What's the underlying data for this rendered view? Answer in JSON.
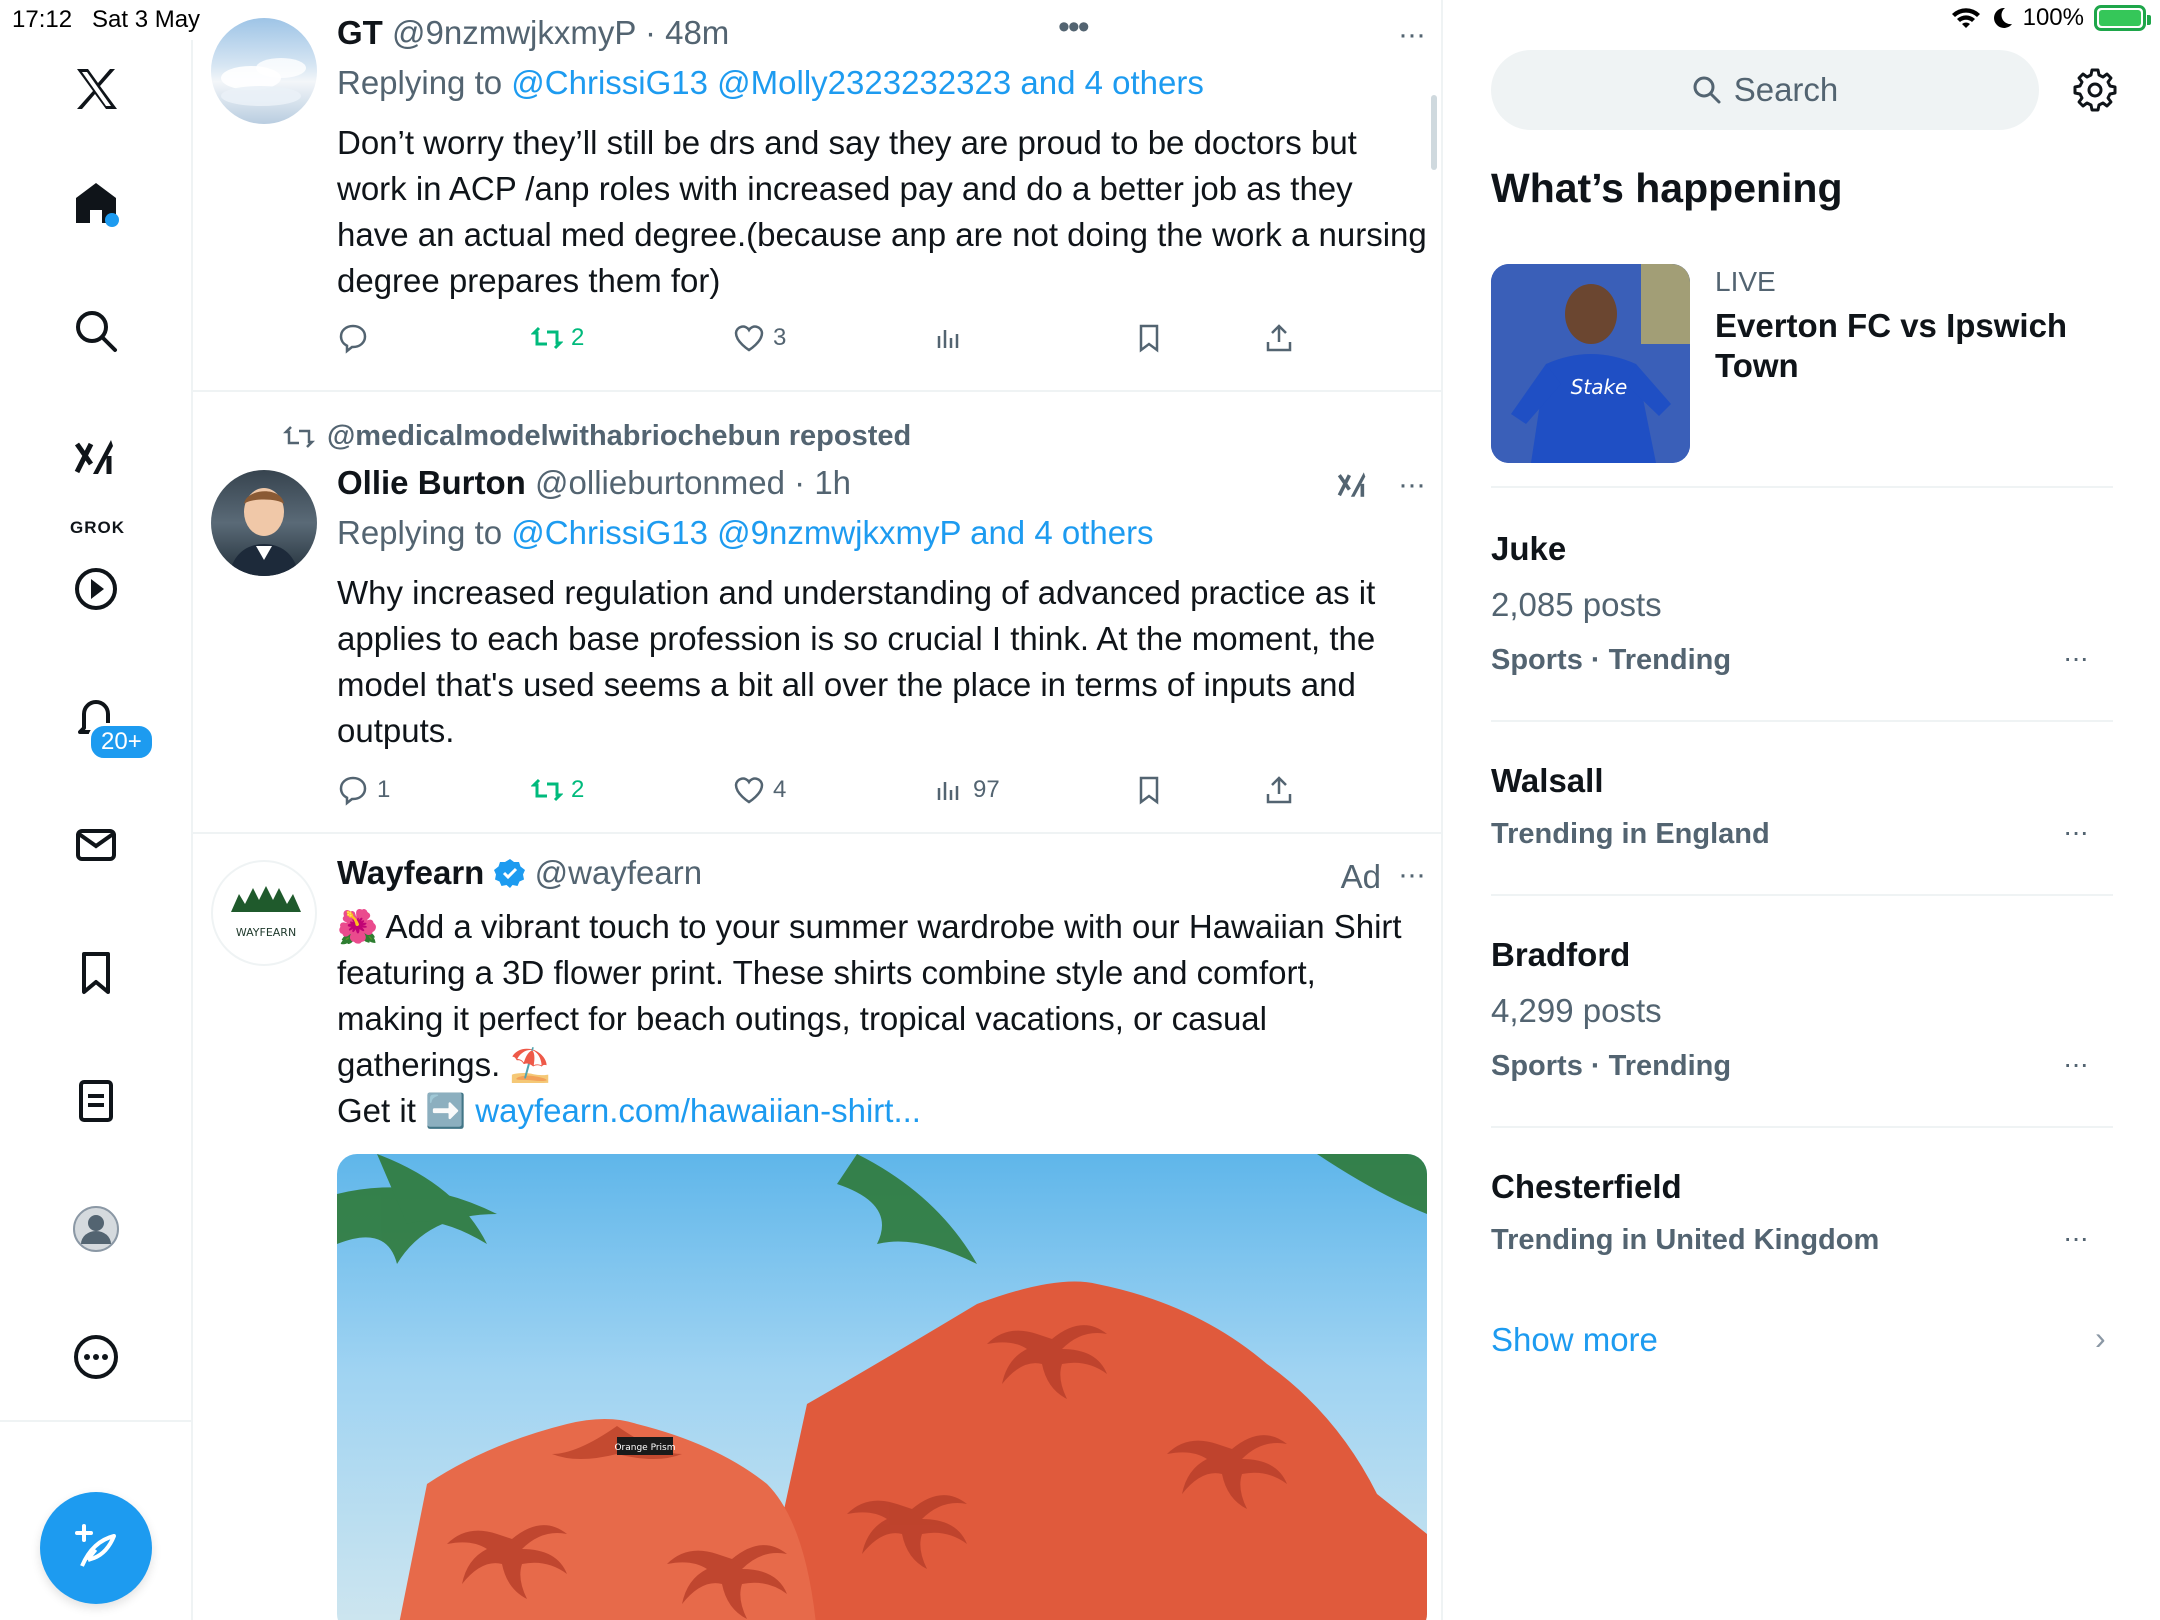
{
  "status_bar": {
    "time": "17:12",
    "date": "Sat 3 May",
    "battery": "100%"
  },
  "nav": {
    "items": [
      "x-logo",
      "home",
      "explore",
      "grok",
      "videos",
      "notifications",
      "messages",
      "bookmarks",
      "lists",
      "profile",
      "more"
    ],
    "grok_label": "GROK",
    "notification_badge": "20+"
  },
  "feed": {
    "tweets": [
      {
        "name": "GT",
        "handle": "@9nzmwjkxmyP",
        "time": "· 48m",
        "replying_prefix": "Replying to",
        "replying_to": "@ChrissiG13 @Molly2323232323 and 4 others",
        "text": "Don’t worry they’ll still be drs and say they are proud to be doctors but work in ACP /anp roles with increased pay and do a better job as they have an actual med degree.(because anp are not doing the work a nursing degree prepares them for)",
        "replies": "",
        "reposts": "2",
        "likes": "3",
        "views": "",
        "more": "···"
      },
      {
        "reposted_by": "@medicalmodelwithabriochebun reposted",
        "name": "Ollie Burton",
        "handle": "@ollieburtonmed",
        "time": "· 1h",
        "replying_prefix": "Replying to",
        "replying_to": "@ChrissiG13 @9nzmwjkxmyP and 4 others",
        "text": "Why increased regulation and understanding of advanced practice as it applies to each base profession is so crucial I think. At the moment, the model that's used seems a bit all over the place in terms of inputs and outputs.",
        "replies": "1",
        "reposts": "2",
        "likes": "4",
        "views": "97",
        "more": "···"
      },
      {
        "name": "Wayfearn",
        "handle": "@wayfearn",
        "ad_label": "Ad",
        "avatar_text": "WAYFEARN",
        "emoji_start": "🌺",
        "text_main": "Add a vibrant touch to your summer wardrobe with our Hawaiian Shirt featuring a 3D flower print. These shirts combine style and comfort, making it perfect for beach outings, tropical vacations, or casual gatherings.",
        "emoji_end": "⛱️",
        "get_it": "Get it",
        "arrow": "➡️",
        "link": "wayfearn.com/hawaiian-shirt...",
        "shirt_tag": "Orange Prism",
        "more": "···"
      }
    ]
  },
  "right": {
    "search_placeholder": "Search",
    "whats_happening": "What’s happening",
    "live": {
      "tag": "LIVE",
      "title": "Everton FC vs Ipswich Town",
      "image_text": "Stake"
    },
    "trends": [
      {
        "name": "Juke",
        "posts": "2,085 posts",
        "context": "Sports · Trending"
      },
      {
        "name": "Walsall",
        "posts": "",
        "context": "Trending in England"
      },
      {
        "name": "Bradford",
        "posts": "4,299 posts",
        "context": "Sports · Trending"
      },
      {
        "name": "Chesterfield",
        "posts": "",
        "context": "Trending in United Kingdom"
      }
    ],
    "show_more": "Show more"
  },
  "colors": {
    "accent": "#1d9bf0",
    "repost_green": "#00ba7c",
    "secondary_text": "#536471",
    "divider": "#eff3f4"
  }
}
